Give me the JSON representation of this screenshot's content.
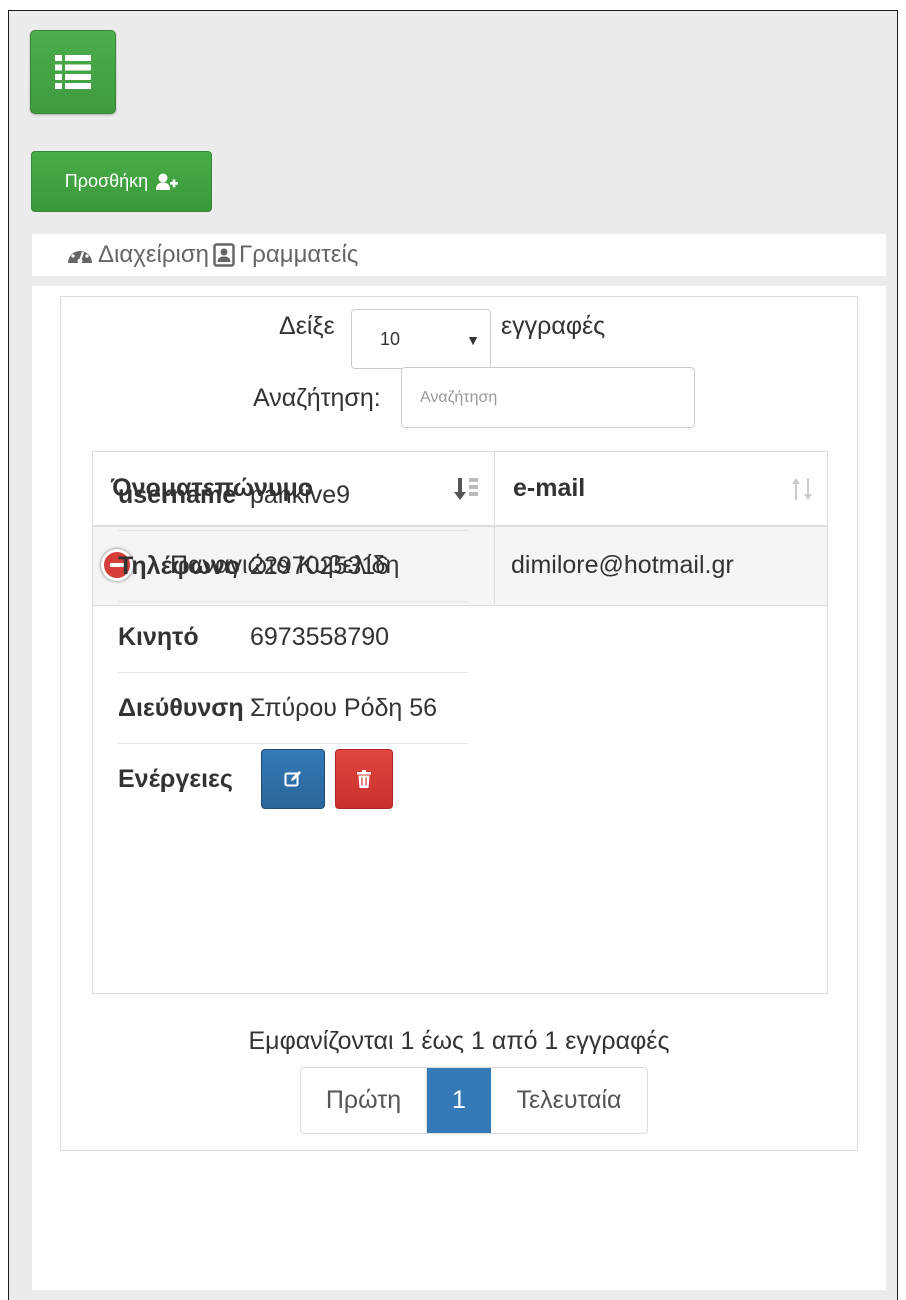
{
  "toolbar": {
    "menu_icon": "list-icon",
    "add_label": "Προσθήκη",
    "add_icon": "user-plus-icon"
  },
  "breadcrumb": {
    "items": [
      {
        "label": "Διαχείριση",
        "icon": "dashboard-icon"
      },
      {
        "label": "Γραμματείς",
        "icon": "contact-card-icon"
      }
    ]
  },
  "table_controls": {
    "show_prefix": "Δείξε",
    "page_size": "10",
    "show_suffix": "εγγραφές",
    "search_label": "Αναζήτηση:",
    "search_placeholder": "Αναζήτηση"
  },
  "table": {
    "columns": [
      "Όνοματεπώνυμο",
      "e-mail"
    ],
    "rows": [
      {
        "name": "Παναγιώτα Κυβελίδη",
        "email": "dimilore@hotmail.gr"
      }
    ]
  },
  "details": {
    "items": [
      {
        "key": "username",
        "value": "pankive9"
      },
      {
        "key": "Τηλέφωνο",
        "value": "2297025316"
      },
      {
        "key": "Κινητό",
        "value": "6973558790"
      },
      {
        "key": "Διεύθυνση",
        "value": "Σπύρου Ρόδη 56"
      }
    ],
    "actions_label": "Ενέργειες",
    "edit_icon": "edit-icon",
    "delete_icon": "trash-icon"
  },
  "pagination": {
    "info": "Εμφανίζονται 1 έως 1 από 1 εγγραφές",
    "first": "Πρώτη",
    "current": "1",
    "last": "Τελευταία"
  },
  "colors": {
    "success": "#449d44",
    "primary": "#337ab7",
    "danger": "#d43f3a"
  }
}
